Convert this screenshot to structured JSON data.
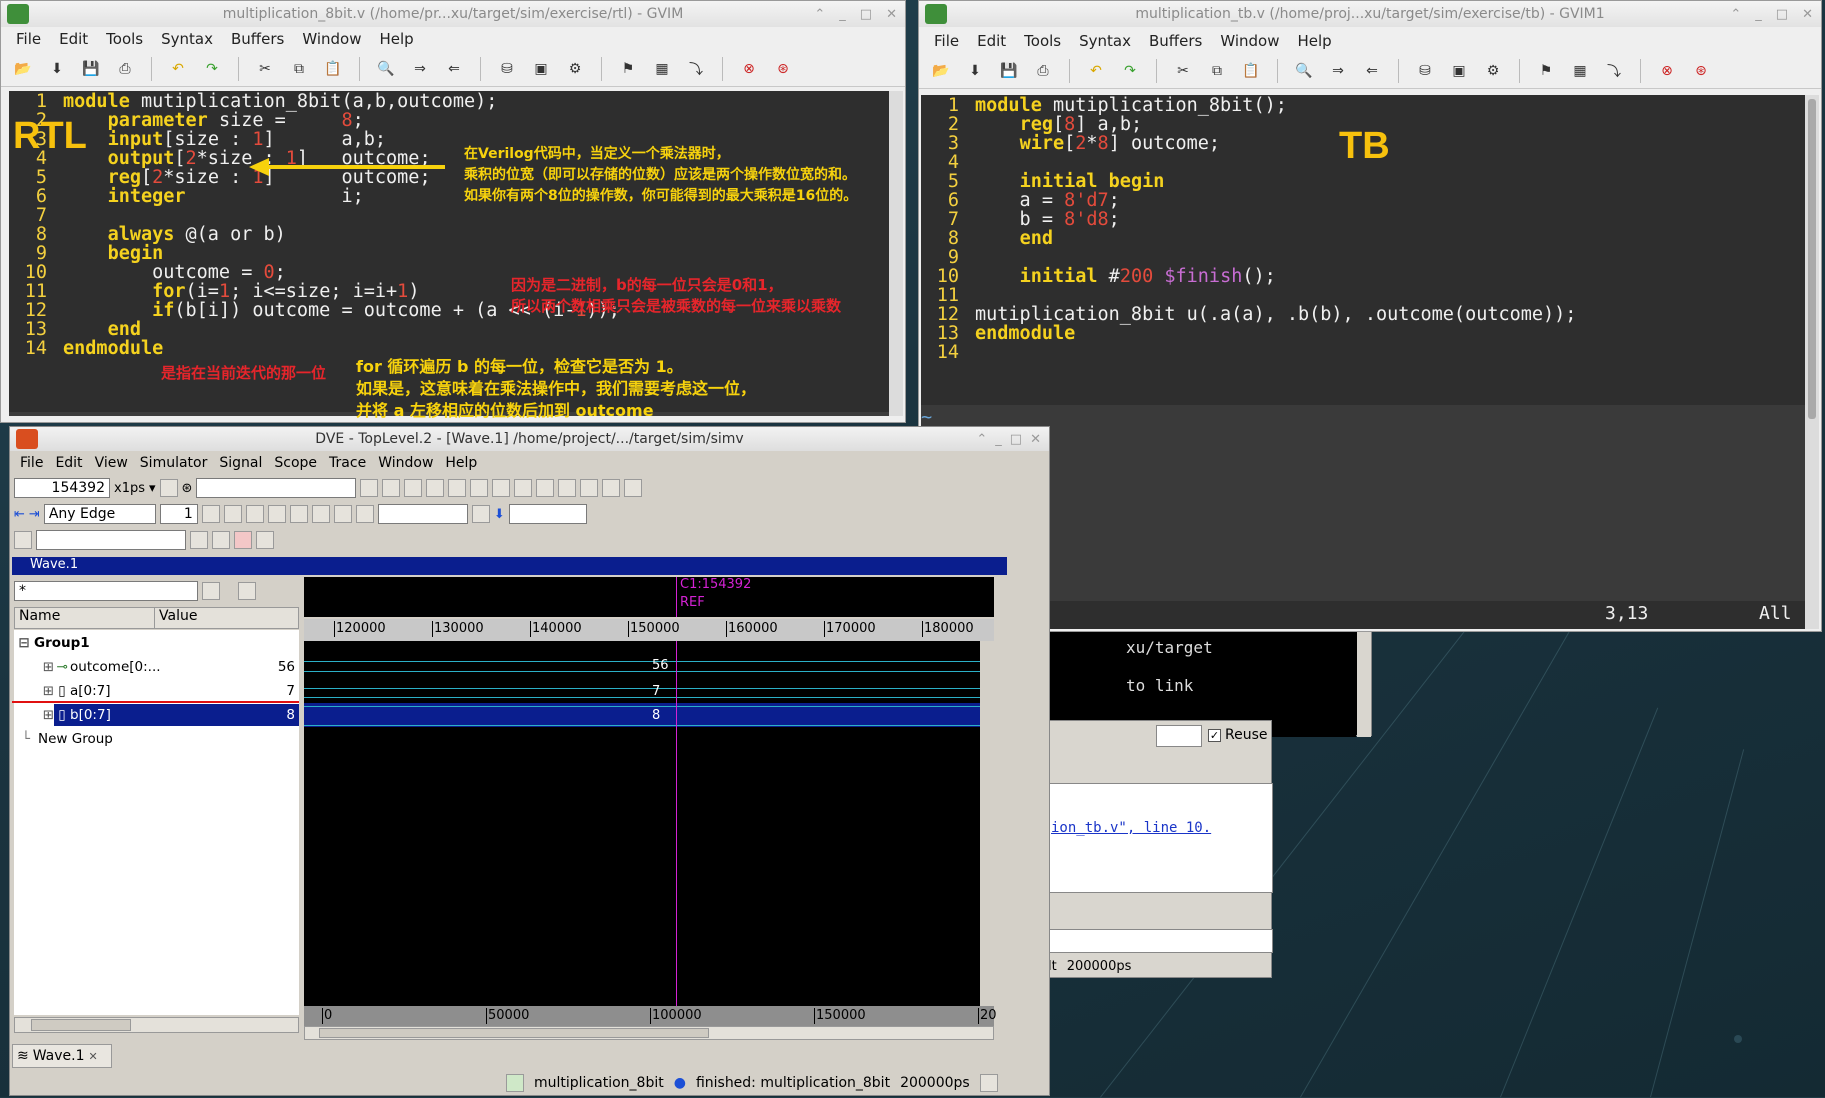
{
  "rtl_window": {
    "title": "multiplication_8bit.v (/home/pr...xu/target/sim/exercise/rtl) - GVIM",
    "menu": [
      "File",
      "Edit",
      "Tools",
      "Syntax",
      "Buffers",
      "Window",
      "Help"
    ],
    "line_numbers": [
      "1",
      "2",
      "3",
      "4",
      "5",
      "6",
      "7",
      "8",
      "9",
      "10",
      "11",
      "12",
      "13",
      "14"
    ],
    "code": [
      "module mutiplication_8bit(a,b,outcome);",
      "    parameter size =     8;",
      "    input[size : 1]      a,b;",
      "    output[2*size : 1]   outcome;",
      "    reg[2*size : 1]      outcome;",
      "    integer              i;",
      "",
      "    always @(a or b)",
      "    begin",
      "        outcome = 0;",
      "        for(i=1; i<=size; i=i+1)",
      "        if(b[i]) outcome = outcome + (a << (i-1));",
      "    end",
      "endmodule"
    ],
    "tilde": "~",
    "label": "RTL",
    "annotations": {
      "width_note": [
        "在Verilog代码中，当定义一个乘法器时，",
        "乘积的位宽（即可以存储的位数）应该是两个操作数位宽的和。",
        "如果你有两个8位的操作数，你可能得到的最大乘积是16位的。"
      ],
      "binary_note": [
        "因为是二进制，b的每一位只会是0和1，",
        "所以两个数相乘只会是被乘数的每一位来乘以乘数"
      ],
      "index_note": "是指在当前迭代的那一位",
      "loop_note": [
        "for 循环遍历 b 的每一位，检查它是否为 1。",
        "如果是，这意味着在乘法操作中，我们需要考虑这一位，",
        "并将 a 左移相应的位数后加到 outcome"
      ]
    }
  },
  "tb_window": {
    "title": "multiplication_tb.v (/home/proj...xu/target/sim/exercise/tb) - GVIM1",
    "menu": [
      "File",
      "Edit",
      "Tools",
      "Syntax",
      "Buffers",
      "Window",
      "Help"
    ],
    "line_numbers": [
      "1",
      "2",
      "3",
      "4",
      "5",
      "6",
      "7",
      "8",
      "9",
      "10",
      "11",
      "12",
      "13",
      "14"
    ],
    "code": [
      "module mutiplication_8bit();",
      "    reg[8] a,b;",
      "    wire[2*8] outcome;",
      "",
      "    initial begin",
      "    a = 8'd7;",
      "    b = 8'd8;",
      "    end",
      "",
      "    initial #200 $finish();",
      "",
      "mutiplication_8bit u(.a(a), .b(b), .outcome(outcome));",
      "endmodule",
      ""
    ],
    "tilde": "~",
    "label": "TB",
    "status_pos": "3,13",
    "status_all": "All"
  },
  "dve_window": {
    "title": "DVE - TopLevel.2 - [Wave.1]  /home/project/.../target/sim/simv",
    "menu": [
      "File",
      "Edit",
      "View",
      "Simulator",
      "Signal",
      "Scope",
      "Trace",
      "Window",
      "Help"
    ],
    "time_value": "154392",
    "time_unit": "x1ps",
    "edge_mode": "Any Edge",
    "edge_count": "1",
    "wave_title": "Wave.1",
    "filter_value": "*",
    "col_name": "Name",
    "col_value": "Value",
    "signals": [
      {
        "name": "Group1",
        "value": ""
      },
      {
        "name": "outcome[0:...",
        "value": "56"
      },
      {
        "name": "a[0:7]",
        "value": "7"
      },
      {
        "name": "b[0:7]",
        "value": "8"
      },
      {
        "name": "New Group",
        "value": ""
      }
    ],
    "cursor_label": "C1:154392",
    "ref_label": "REF",
    "top_ticks": [
      "120000",
      "130000",
      "140000",
      "150000",
      "160000",
      "170000",
      "180000"
    ],
    "bottom_ticks": [
      "0",
      "50000",
      "100000",
      "150000",
      "20"
    ],
    "wave_values": [
      "56",
      "7",
      "8"
    ],
    "tab_label": "Wave.1",
    "status_module": "multiplication_8bit",
    "status_finished": "finished: multiplication_8bit",
    "status_time": "200000ps"
  },
  "background": {
    "term_lines": [
      "xu/target",
      "to link"
    ],
    "reuse_label": "Reuse",
    "link_text": "ion_tb.v\", line 10.",
    "bg_time": "200000ps",
    "bg_status_prefix": "lt"
  }
}
